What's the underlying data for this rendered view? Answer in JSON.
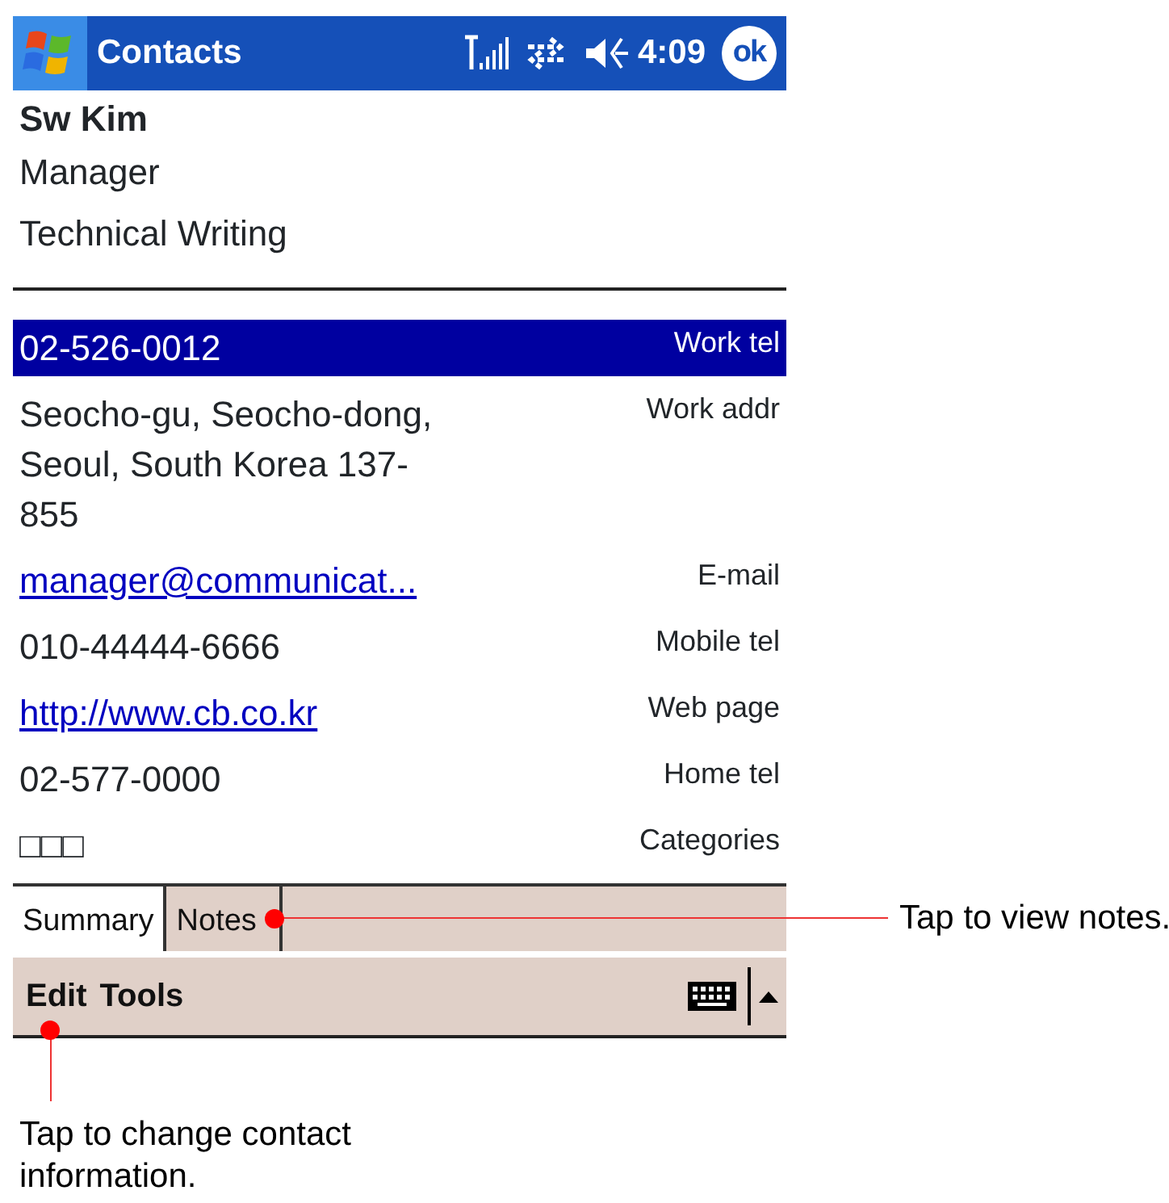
{
  "title_bar": {
    "title": "Contacts",
    "time": "4:09",
    "ok": "ok"
  },
  "contact": {
    "name": "Sw Kim",
    "job_title": "Manager",
    "department": "Technical Writing"
  },
  "fields": [
    {
      "kind": "text",
      "value_lines": [
        "02-526-0012"
      ],
      "label": "Work tel",
      "selected": true
    },
    {
      "kind": "text",
      "value_lines": [
        "Seocho-gu, Seocho-dong,",
        "Seoul, South Korea 137-",
        "855"
      ],
      "label": "Work addr",
      "selected": false
    },
    {
      "kind": "link",
      "value_lines": [
        "manager@communicat..."
      ],
      "label": "E-mail",
      "selected": false
    },
    {
      "kind": "text",
      "value_lines": [
        "010-44444-6666"
      ],
      "label": "Mobile tel",
      "selected": false
    },
    {
      "kind": "link",
      "value_lines": [
        "http://www.cb.co.kr"
      ],
      "label": "Web page",
      "selected": false
    },
    {
      "kind": "text",
      "value_lines": [
        "02-577-0000"
      ],
      "label": "Home tel",
      "selected": false
    },
    {
      "kind": "text",
      "value_lines": [
        "□□□"
      ],
      "label": "Categories",
      "selected": false
    }
  ],
  "tabs": [
    {
      "label": "Summary",
      "selected": true
    },
    {
      "label": "Notes",
      "selected": false
    }
  ],
  "menu_bar": {
    "items": [
      "Edit",
      "Tools"
    ]
  },
  "callouts": [
    {
      "kind": "right",
      "text": "Tap to view notes."
    },
    {
      "kind": "below",
      "text": "Tap to change contact information."
    }
  ]
}
